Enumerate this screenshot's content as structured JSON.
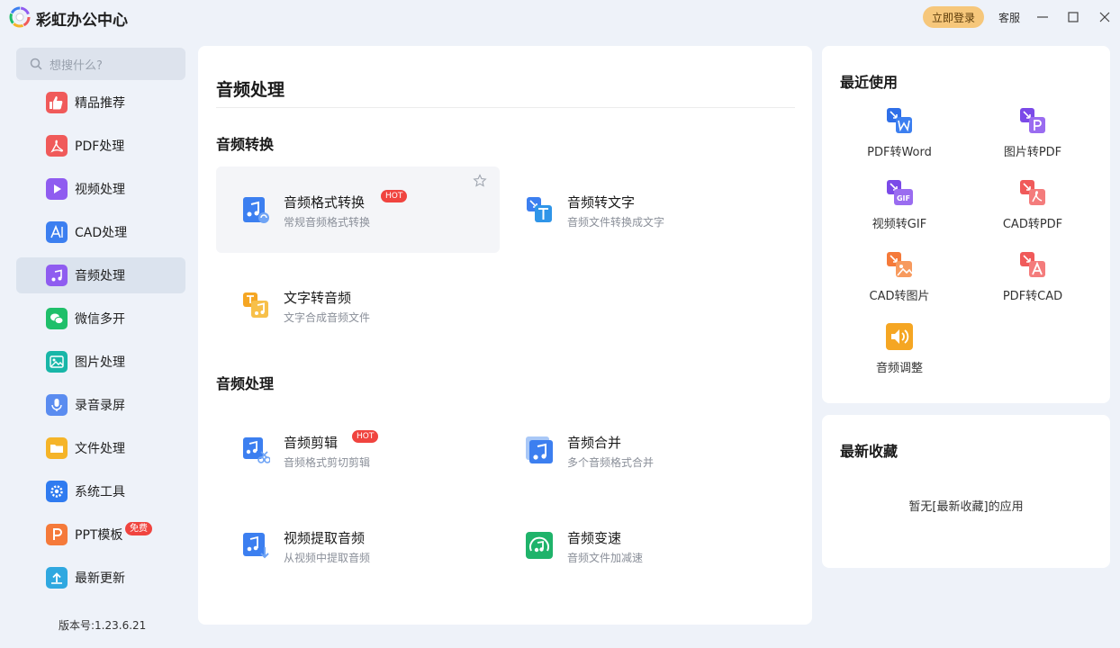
{
  "app": {
    "title": "彩虹办公中心",
    "login_label": "立即登录",
    "service_label": "客服"
  },
  "sidebar": {
    "search_placeholder": "想搜什么?",
    "items": [
      {
        "label": "精品推荐",
        "icon": "thumbs-up-icon",
        "color": "#f05a5a"
      },
      {
        "label": "PDF处理",
        "icon": "pdf-icon",
        "color": "#f05a5a"
      },
      {
        "label": "视频处理",
        "icon": "play-icon",
        "color": "#8f5cf0"
      },
      {
        "label": "CAD处理",
        "icon": "cad-icon",
        "color": "#3c7ff0"
      },
      {
        "label": "音频处理",
        "icon": "music-note-icon",
        "color": "#8f5cf0"
      },
      {
        "label": "微信多开",
        "icon": "wechat-icon",
        "color": "#1fbf6a"
      },
      {
        "label": "图片处理",
        "icon": "image-icon",
        "color": "#18b6a8"
      },
      {
        "label": "录音录屏",
        "icon": "microphone-icon",
        "color": "#5a8cf0"
      },
      {
        "label": "文件处理",
        "icon": "folder-icon",
        "color": "#f5b428"
      },
      {
        "label": "系统工具",
        "icon": "gear-icon",
        "color": "#2f7bf0"
      },
      {
        "label": "PPT模板",
        "icon": "ppt-icon",
        "color": "#f57a3a",
        "badge": "免费"
      },
      {
        "label": "最新更新",
        "icon": "upload-icon",
        "color": "#2fa8e0"
      }
    ],
    "active_index": 4,
    "version": "版本号:1.23.6.21"
  },
  "main": {
    "title": "音频处理",
    "sections": [
      {
        "title": "音频转换",
        "tools": [
          {
            "name": "音频格式转换",
            "desc": "常规音频格式转换",
            "hot": "HOT",
            "icon": "audio-format-convert-icon"
          },
          {
            "name": "音频转文字",
            "desc": "音频文件转换成文字",
            "icon": "audio-to-text-icon"
          },
          {
            "name": "文字转音频",
            "desc": "文字合成音频文件",
            "icon": "text-to-audio-icon"
          }
        ]
      },
      {
        "title": "音频处理",
        "tools": [
          {
            "name": "音频剪辑",
            "desc": "音频格式剪切剪辑",
            "hot": "HOT",
            "icon": "audio-cut-icon"
          },
          {
            "name": "音频合并",
            "desc": "多个音频格式合并",
            "icon": "audio-merge-icon"
          },
          {
            "name": "视频提取音频",
            "desc": "从视频中提取音频",
            "icon": "video-extract-audio-icon"
          },
          {
            "name": "音频变速",
            "desc": "音频文件加减速",
            "icon": "audio-speed-icon"
          }
        ]
      }
    ]
  },
  "recent": {
    "title": "最近使用",
    "items": [
      {
        "label": "PDF转Word",
        "icon": "pdf-to-word-icon"
      },
      {
        "label": "图片转PDF",
        "icon": "image-to-pdf-icon"
      },
      {
        "label": "视频转GIF",
        "icon": "video-to-gif-icon"
      },
      {
        "label": "CAD转PDF",
        "icon": "cad-to-pdf-icon"
      },
      {
        "label": "CAD转图片",
        "icon": "cad-to-image-icon"
      },
      {
        "label": "PDF转CAD",
        "icon": "pdf-to-cad-icon"
      },
      {
        "label": "音频调整",
        "icon": "audio-adjust-icon"
      }
    ]
  },
  "favorites": {
    "title": "最新收藏",
    "empty_text": "暂无[最新收藏]的应用"
  }
}
